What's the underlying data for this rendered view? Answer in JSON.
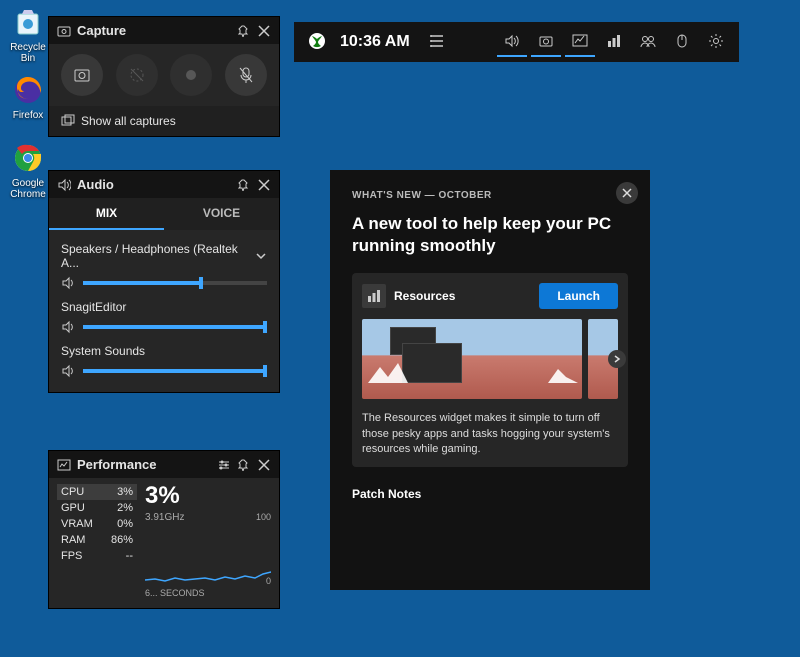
{
  "desktop": {
    "icons": [
      {
        "name": "recycle-bin",
        "label": "Recycle Bin"
      },
      {
        "name": "firefox",
        "label": "Firefox"
      },
      {
        "name": "chrome",
        "label": "Google Chrome"
      }
    ]
  },
  "capture": {
    "title": "Capture",
    "buttons": [
      "screenshot",
      "record-last",
      "record",
      "mic-mute"
    ],
    "show_all": "Show all captures"
  },
  "audio": {
    "title": "Audio",
    "tabs": {
      "mix": "MIX",
      "voice": "VOICE",
      "active": "mix"
    },
    "devices": [
      {
        "name": "Speakers / Headphones (Realtek A...",
        "level": 63,
        "dropdown": true
      },
      {
        "name": "SnagitEditor",
        "level": 100
      },
      {
        "name": "System Sounds",
        "level": 100
      }
    ]
  },
  "perf": {
    "title": "Performance",
    "stats": [
      {
        "label": "CPU",
        "value": "3%",
        "selected": true
      },
      {
        "label": "GPU",
        "value": "2%"
      },
      {
        "label": "VRAM",
        "value": "0%"
      },
      {
        "label": "RAM",
        "value": "86%"
      },
      {
        "label": "FPS",
        "value": "--"
      }
    ],
    "big": "3%",
    "sub": "3.91GHz",
    "ymax": "100",
    "ymin": "0",
    "xlabel": "6... SECONDS"
  },
  "topbar": {
    "time": "10:36 AM",
    "icons": [
      "xbox",
      "menu",
      "audio",
      "capture",
      "performance",
      "resources",
      "social",
      "mouse",
      "settings"
    ],
    "highlighted": [
      "audio",
      "capture",
      "performance"
    ]
  },
  "news": {
    "header": "WHAT'S NEW — OCTOBER",
    "title": "A new tool to help keep your PC running smoothly",
    "card_icon": "resources-icon",
    "card_name": "Resources",
    "launch": "Launch",
    "desc": "The Resources widget makes it simple to turn off those pesky apps and tasks hogging your system's resources while gaming.",
    "patch": "Patch Notes"
  },
  "colors": {
    "accent": "#3ea6ff",
    "primary_blue": "#0d78d6"
  }
}
